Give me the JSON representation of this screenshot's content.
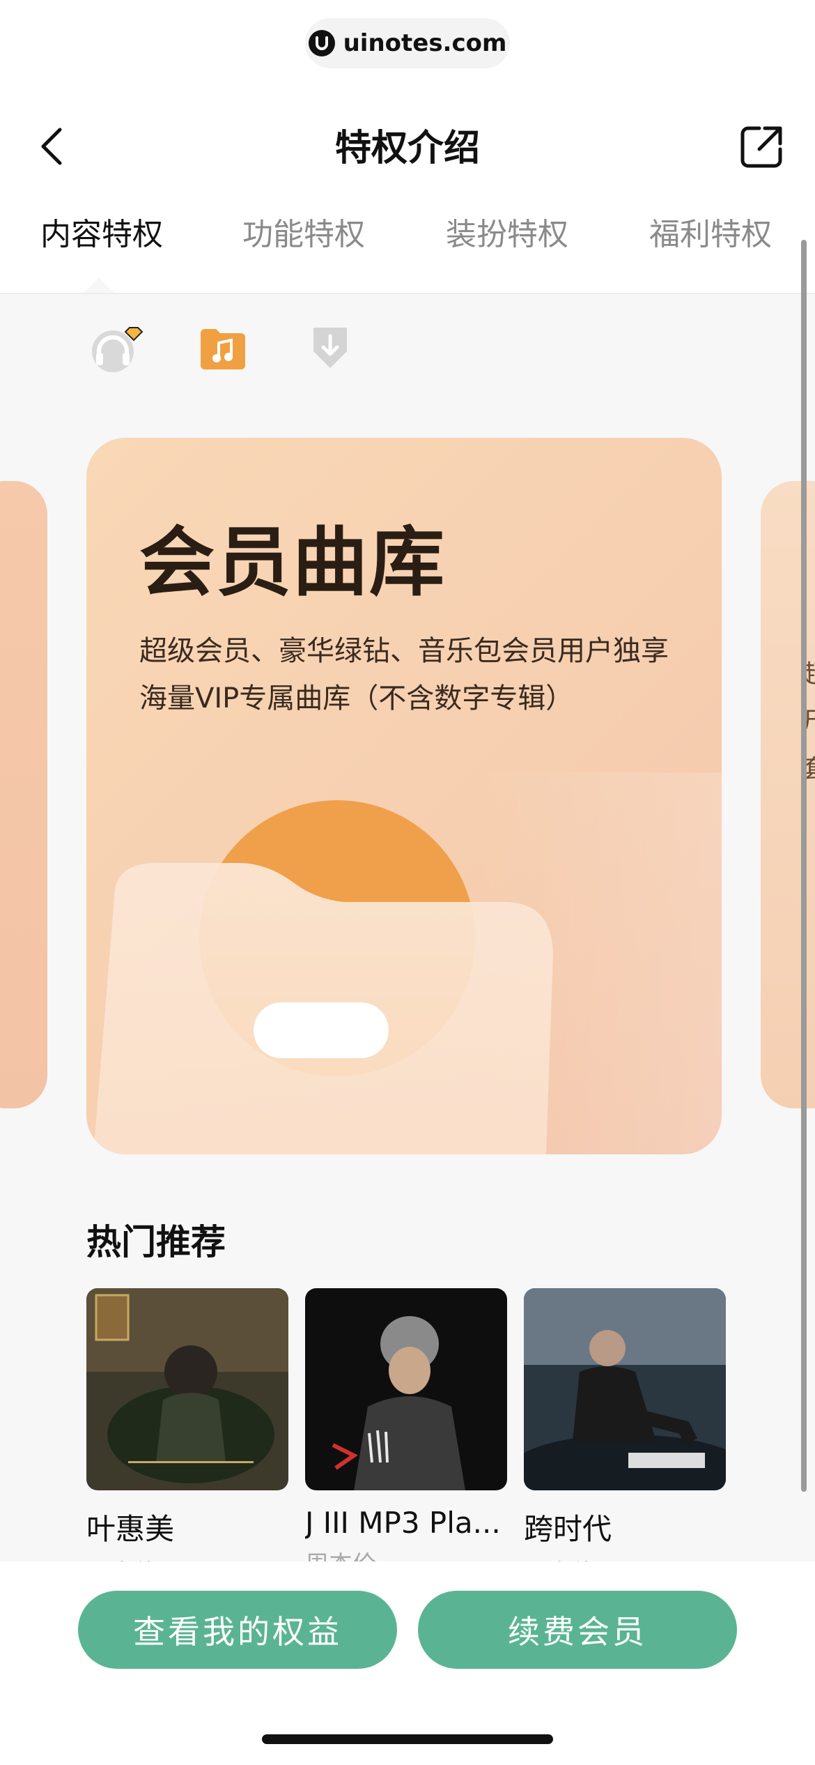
{
  "url_bar": {
    "domain": "uinotes.com",
    "logo_icon": "uinotes-logo-icon"
  },
  "header": {
    "title": "特权介绍",
    "back_icon": "chevron-left-icon",
    "share_icon": "share-external-icon"
  },
  "tabs": [
    {
      "label": "内容特权",
      "active": true
    },
    {
      "label": "功能特权",
      "active": false
    },
    {
      "label": "装扮特权",
      "active": false
    },
    {
      "label": "福利特权",
      "active": false
    }
  ],
  "privilege_icons": [
    {
      "name": "headphones-vip-icon",
      "selected": false
    },
    {
      "name": "music-folder-icon",
      "selected": true
    },
    {
      "name": "download-icon",
      "selected": false
    }
  ],
  "card": {
    "title": "会员曲库",
    "description": "超级会员、豪华绿钻、音乐包会员用户独享海量VIP专属曲库（不含数字专辑）"
  },
  "side_card_fragments": [
    "超",
    "尺",
    "套"
  ],
  "hot": {
    "title": "热门推荐",
    "albums": [
      {
        "name": "叶惠美",
        "artist": "周杰伦"
      },
      {
        "name": "J III MP3 Pla...",
        "artist": "周杰伦"
      },
      {
        "name": "跨时代",
        "artist": "周杰伦"
      }
    ]
  },
  "actions": {
    "view_benefits": "查看我的权益",
    "renew": "续费会员"
  },
  "colors": {
    "accent_green": "#5ab493",
    "card_orange": "#f9d8b6",
    "icon_orange": "#f0a040"
  }
}
